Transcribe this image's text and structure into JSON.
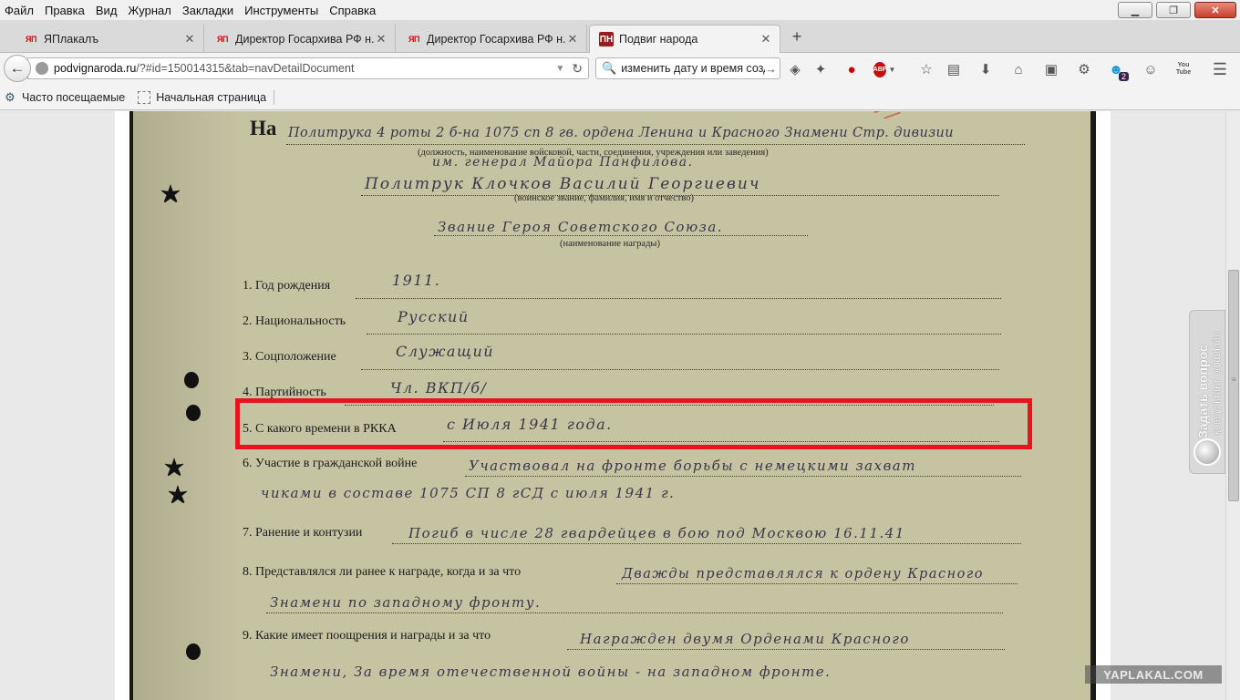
{
  "menu": [
    "Файл",
    "Правка",
    "Вид",
    "Журнал",
    "Закладки",
    "Инструменты",
    "Справка"
  ],
  "tabs": [
    {
      "label": "ЯПлакалъ",
      "favicon": "ЯП"
    },
    {
      "label": "Директор Госархива РФ н...",
      "favicon": "ЯП"
    },
    {
      "label": "Директор Госархива РФ н...",
      "favicon": "ЯП"
    },
    {
      "label": "Подвиг народа",
      "favicon": "ПН",
      "active": true
    }
  ],
  "new_tab": "+",
  "address": {
    "host": "podvignaroda.ru",
    "path": "/?#id=150014315&tab=navDetailDocument"
  },
  "search": {
    "value": "изменить дату и время созда"
  },
  "toolbar_icons": [
    "extension-icon",
    "ghost-icon",
    "record-icon",
    "adblock-icon",
    "bookmark-star-icon",
    "reading-list-icon",
    "download-icon",
    "home-icon",
    "sidebar-icon",
    "gear-icon",
    "notification-icon",
    "chat-icon",
    "youtube-icon",
    "menu-icon"
  ],
  "adblock_label": "ABP",
  "notification_badge": "2",
  "youtube_label": "You Tube",
  "bookmarks": [
    "Часто посещаемые",
    "Начальная страница"
  ],
  "document": {
    "na_label": "На",
    "line1": "Политрука 4 роты 2 б-на 1075 сп 8 гв. ордена Ленина и Красного Знамени Стр. дивизии",
    "caption1": "(должность, наименование войсковой, части, соединения, учреждения или заведения)",
    "line2": "им. генерал Майора Панфилова.",
    "line3": "Политрук Клочков Василий Георгиевич",
    "caption3": "(воинское звание, фамилия, имя и отчество)",
    "line4": "Звание Героя Советского Союза.",
    "caption4": "(наименование награды)",
    "fields": [
      {
        "label": "1. Год рождения",
        "value": "1911."
      },
      {
        "label": "2. Национальность",
        "value": "Русский"
      },
      {
        "label": "3. Соцположение",
        "value": "Служащий"
      },
      {
        "label": "4. Партийность",
        "value": "Чл. ВКП/б/"
      },
      {
        "label": "5. С какого времени  в РККА",
        "value": "с Июля 1941 года."
      },
      {
        "label": "6. Участие в гражданской войне",
        "value": "Участвовал на фронте борьбы с немецкими захват"
      },
      {
        "label": "",
        "value": "чиками в составе 1075 СП 8 гСД с июля 1941 г."
      },
      {
        "label": "7. Ранение и контузии",
        "value": "Погиб в числе 28 гвардейцев в бою под Москвою 16.11.41"
      },
      {
        "label": "8. Представлялся ли ранее к награде,  когда  и за что",
        "value": "Дважды представлялся к ордену Красного"
      },
      {
        "label": "",
        "value": "Знамени по западному фронту."
      },
      {
        "label": "9. Какие имеет поощрения и награды и за что",
        "value": "Награжден двумя Орденами Красного"
      },
      {
        "label": "",
        "value": "Знамени, За время отечественной войны - на западном фронте."
      }
    ]
  },
  "side_widget": {
    "title": "Задать вопрос",
    "subtitle": "консультант оффлайн"
  },
  "watermark": "YAPLAKAL.COM"
}
